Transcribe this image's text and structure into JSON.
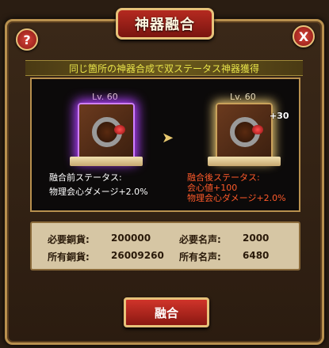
{
  "title": "神器融合",
  "help_button": "?",
  "close_button": "X",
  "banner": "同じ箇所の神器合成で双ステータス神器獲得",
  "before": {
    "level": "Lv. 60",
    "stats_title": "融合前ステータス:",
    "stat_lines": [
      "物理会心ダメージ+2.0%"
    ]
  },
  "after": {
    "level": "Lv. 60",
    "plus": "+30",
    "stats_title": "融合後ステータス:",
    "stat_lines": [
      "会心値+100",
      "物理会心ダメージ+2.0%"
    ]
  },
  "costs": {
    "required_copper_label": "必要銅貨:",
    "required_copper_value": "200000",
    "required_fame_label": "必要名声:",
    "required_fame_value": "2000",
    "owned_copper_label": "所有銅貨:",
    "owned_copper_value": "26009260",
    "owned_fame_label": "所有名声:",
    "owned_fame_value": "6480"
  },
  "merge_button": "融合",
  "colors": {
    "title_plate": "#9a1f16",
    "banner_text": "#e8e44a",
    "after_stat_text": "#ff5a2a",
    "frame_gold": "#b8904e"
  },
  "icons": {
    "artifact": "ring-icon",
    "arrow": "arrow-right-icon"
  }
}
